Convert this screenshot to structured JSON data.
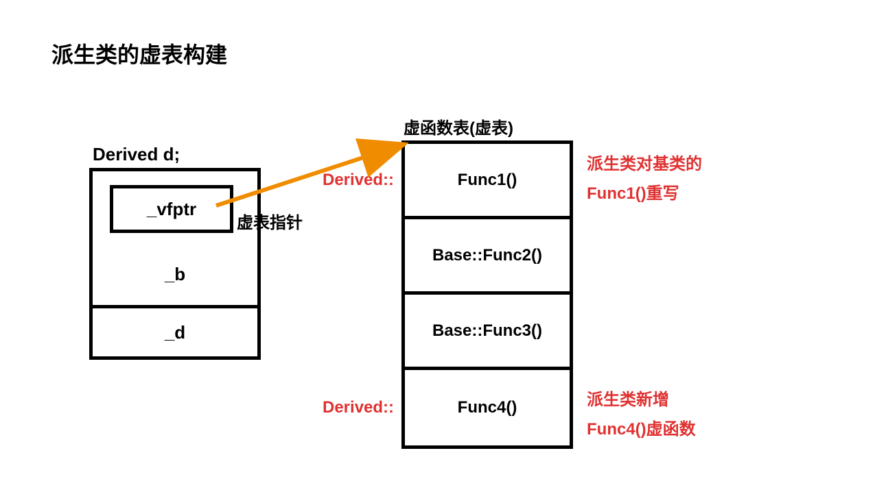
{
  "title": "派生类的虚表构建",
  "object": {
    "label": "Derived d;",
    "vfptr": "_vfptr",
    "member_b": "_b",
    "member_d": "_d"
  },
  "pointer_label": "虚表指针",
  "vtable": {
    "label": "虚函数表(虚表)",
    "rows": [
      {
        "prefix": "Derived::",
        "func": "Func1()"
      },
      {
        "prefix": "Base::",
        "func": "Func2()"
      },
      {
        "prefix": "Base::",
        "func": "Func3()"
      },
      {
        "prefix": "Derived::",
        "func": "Func4()"
      }
    ]
  },
  "notes": {
    "note1_line1": "派生类对基类的",
    "note1_line2": "Func1()重写",
    "note2_line1": "派生类新增",
    "note2_line2": "Func4()虚函数"
  },
  "colors": {
    "arrow": "#f08c00",
    "red": "#e03131"
  }
}
